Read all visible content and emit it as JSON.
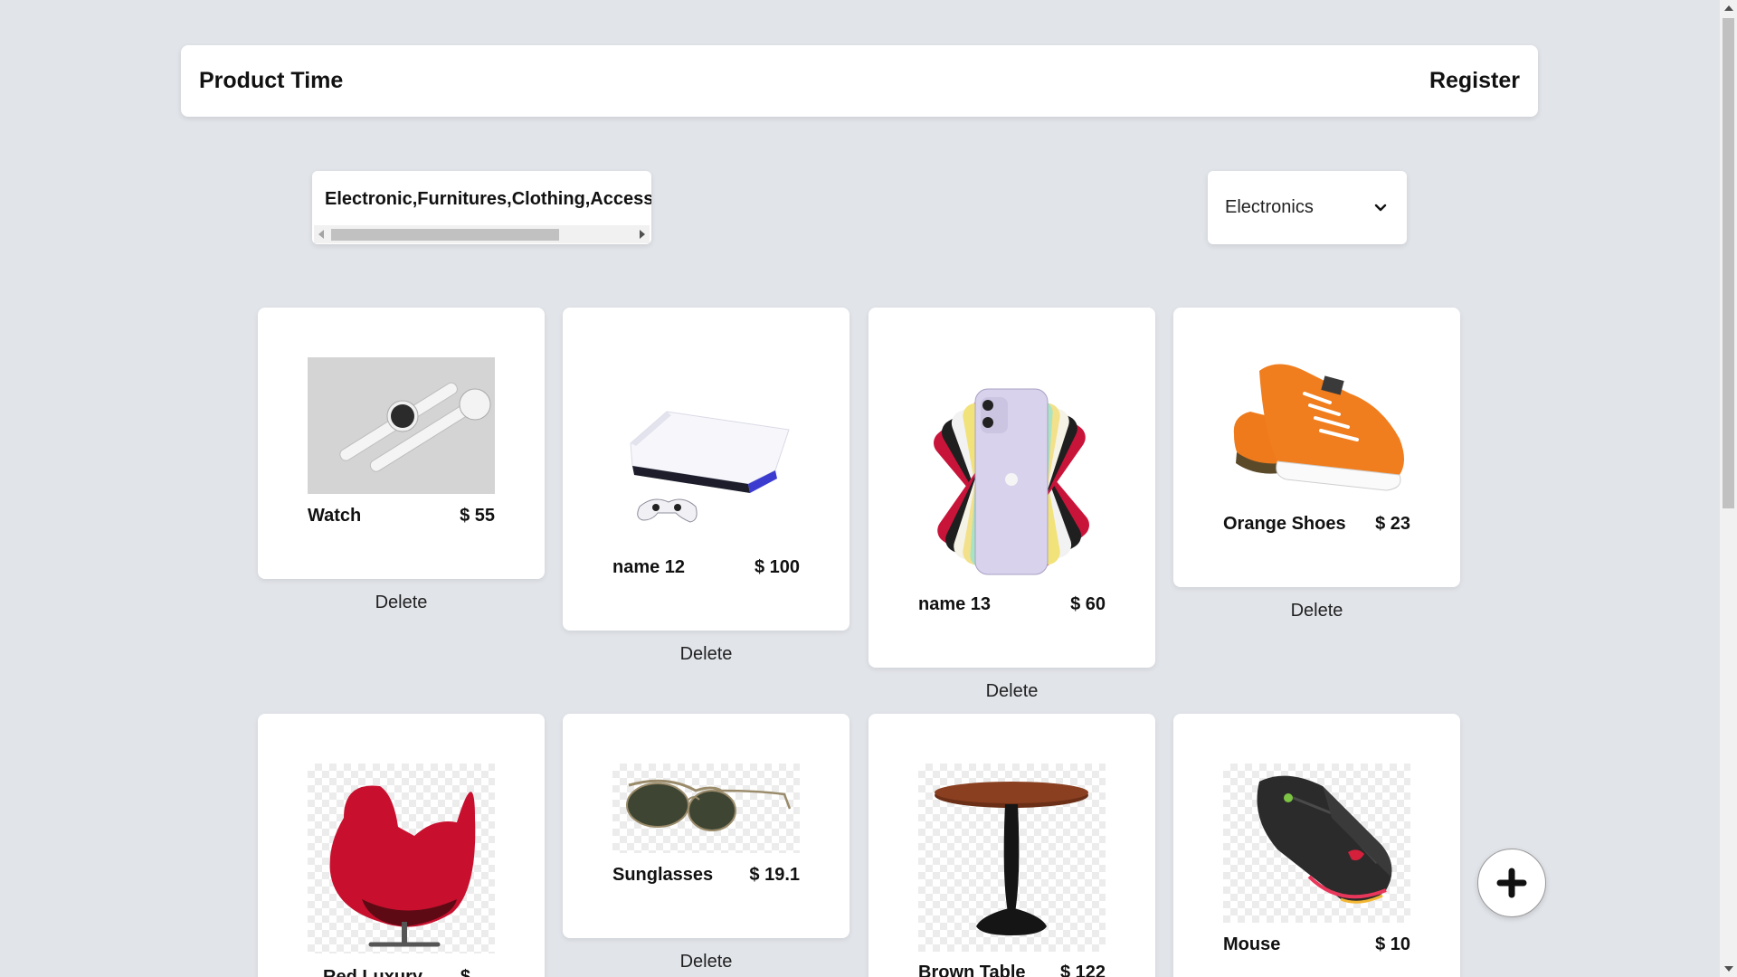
{
  "header": {
    "brand": "Product Time",
    "register_label": "Register"
  },
  "filters": {
    "categories_text": "Electronic,Furnitures,Clothing,Accessories",
    "selected_category": "Electronics"
  },
  "products": [
    {
      "name": "Watch",
      "price": "$ 55",
      "image_icon": "watch-image",
      "delete_label": "Delete"
    },
    {
      "name": "name 12",
      "price": "$ 100",
      "image_icon": "game-console-image",
      "delete_label": "Delete"
    },
    {
      "name": "name 13",
      "price": "$ 60",
      "image_icon": "smartphone-image",
      "delete_label": "Delete"
    },
    {
      "name": "Orange Shoes",
      "price": "$ 23",
      "image_icon": "sneaker-image",
      "delete_label": "Delete"
    },
    {
      "name": "Red Luxury",
      "price": "$",
      "image_icon": "chair-image",
      "delete_label": ""
    },
    {
      "name": "Sunglasses",
      "price": "$ 19.1",
      "image_icon": "sunglasses-image",
      "delete_label": "Delete"
    },
    {
      "name": "Brown Table",
      "price": "$ 122",
      "image_icon": "table-image",
      "delete_label": ""
    },
    {
      "name": "Mouse",
      "price": "$ 10",
      "image_icon": "mouse-image",
      "delete_label": ""
    }
  ],
  "fab": {
    "icon": "plus-icon"
  },
  "colors": {
    "background": "#e1e4e9",
    "card": "#ffffff",
    "accent_shoe": "#f07d1e",
    "accent_chair": "#c8102e"
  }
}
